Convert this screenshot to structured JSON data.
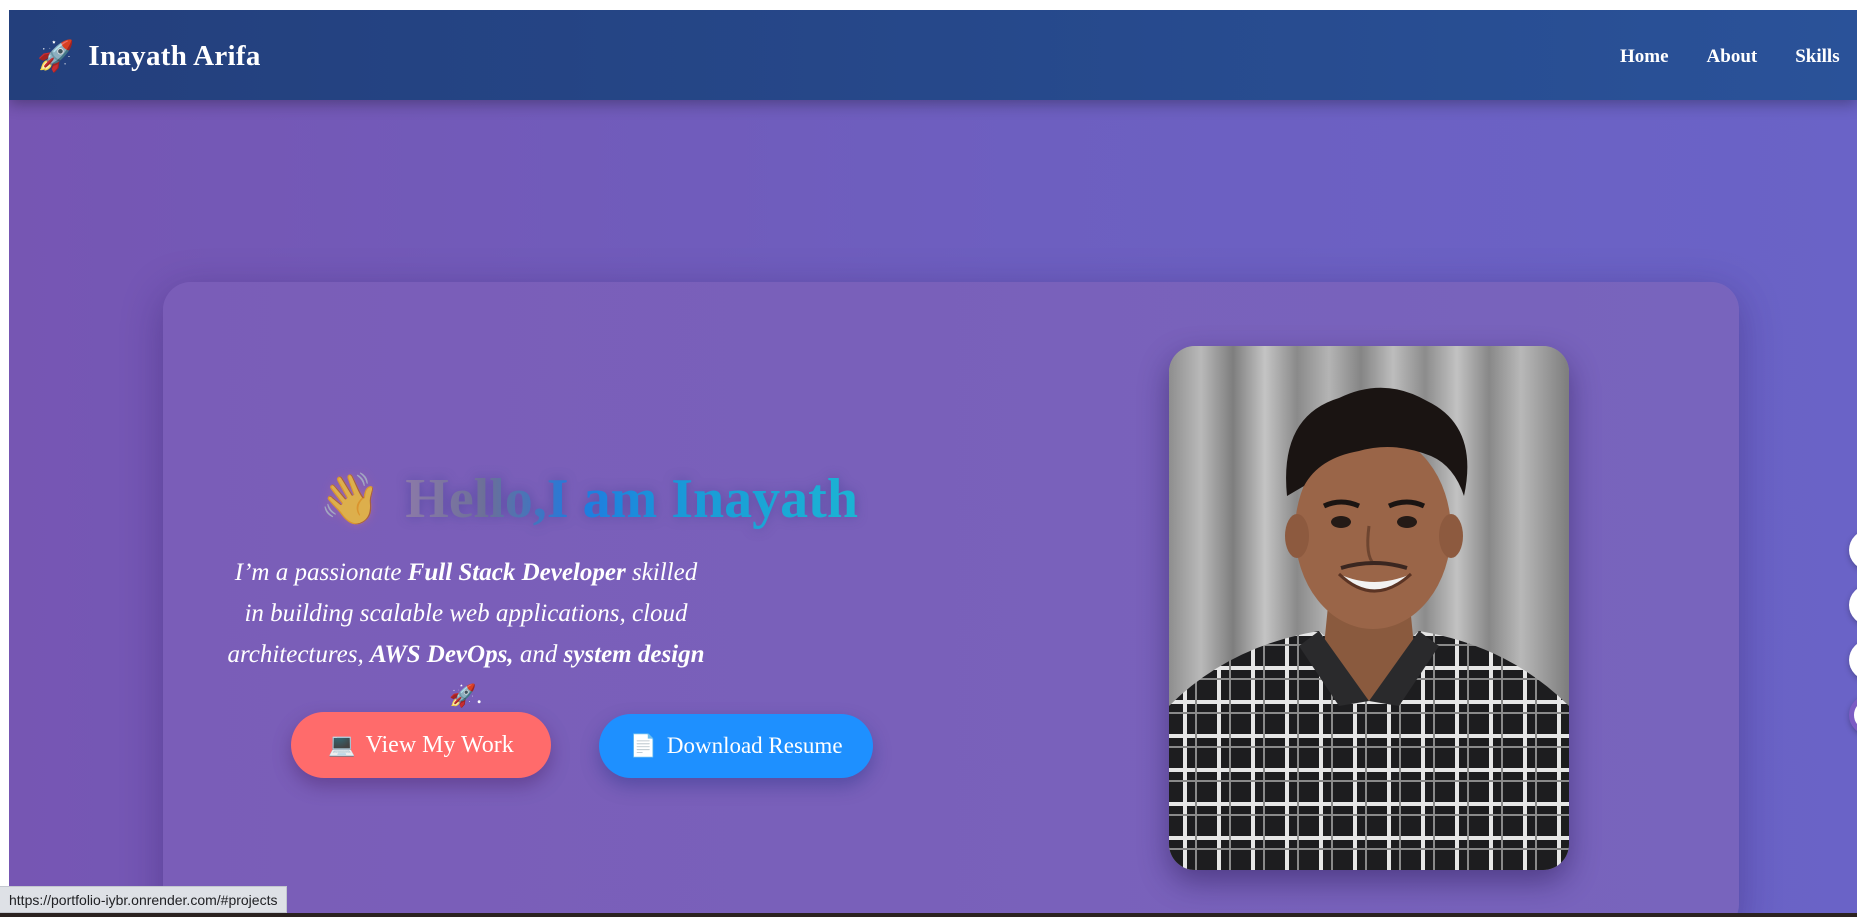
{
  "navbar": {
    "brand_icon": "🚀",
    "brand_name": "Inayath Arifa",
    "links": [
      "Home",
      "About",
      "Skills"
    ]
  },
  "hero": {
    "wave_icon": "👋",
    "title": "Hello,I am Inayath",
    "desc_1": "I’m a passionate ",
    "desc_b1": "Full Stack Developer",
    "desc_2": " skilled in building scalable web applications, cloud architectures, ",
    "desc_b2": "AWS DevOps,",
    "desc_3": " and ",
    "desc_b3": "system design",
    "desc_rocket": "🚀",
    "desc_end": ".",
    "btn_work_icon": "💻",
    "btn_work_label": "View My Work",
    "btn_resume_icon": "📄",
    "btn_resume_label": "Download Resume",
    "photo_alt": "profile-photo"
  },
  "status_bar": {
    "url": "https://portfolio-iybr.onrender.com/#projects"
  },
  "colors": {
    "navbar": "#26488a",
    "background": "#7158bb",
    "btn_work": "#ff6b6b",
    "btn_resume": "#1e90ff"
  }
}
